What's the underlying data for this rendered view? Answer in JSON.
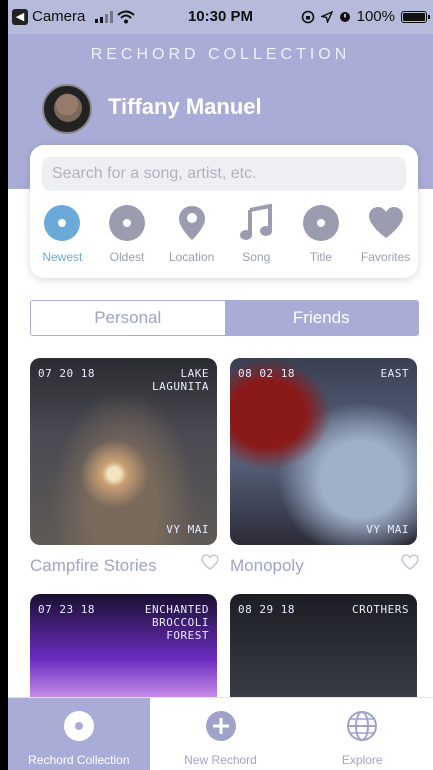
{
  "status_bar": {
    "back_app": "Camera",
    "time": "10:30 PM",
    "battery": "100%"
  },
  "header": {
    "title": "RECHORD COLLECTION",
    "user_name": "Tiffany Manuel"
  },
  "search": {
    "placeholder": "Search for a song, artist, etc."
  },
  "filters": [
    {
      "label": "Newest",
      "icon": "disc-icon",
      "active": true
    },
    {
      "label": "Oldest",
      "icon": "disc-icon",
      "active": false
    },
    {
      "label": "Location",
      "icon": "map-pin-icon",
      "active": false
    },
    {
      "label": "Song",
      "icon": "music-note-icon",
      "active": false
    },
    {
      "label": "Title",
      "icon": "disc-icon",
      "active": false
    },
    {
      "label": "Favorites",
      "icon": "heart-icon",
      "active": false
    }
  ],
  "tabs": {
    "personal": "Personal",
    "friends": "Friends",
    "selected": "friends"
  },
  "cards": [
    {
      "date": "07 20 18",
      "location": "LAKE\nLAGUNITA",
      "author": "VY MAI",
      "title": "Campfire Stories"
    },
    {
      "date": "08 02 18",
      "location": "EAST",
      "author": "VY MAI",
      "title": "Monopoly"
    },
    {
      "date": "07 23 18",
      "location": "ENCHANTED\nBROCCOLI\nFOREST",
      "author": "",
      "title": ""
    },
    {
      "date": "08 29 18",
      "location": "CROTHERS",
      "author": "",
      "title": ""
    }
  ],
  "bottom_nav": [
    {
      "label": "Rechord Collection",
      "icon": "disc-icon",
      "active": true
    },
    {
      "label": "New Rechord",
      "icon": "plus-circle-icon",
      "active": false
    },
    {
      "label": "Explore",
      "icon": "globe-icon",
      "active": false
    }
  ],
  "colors": {
    "accent": "#a8acd6",
    "active_blue": "#6aa9d8",
    "muted": "#9fa3c9"
  }
}
